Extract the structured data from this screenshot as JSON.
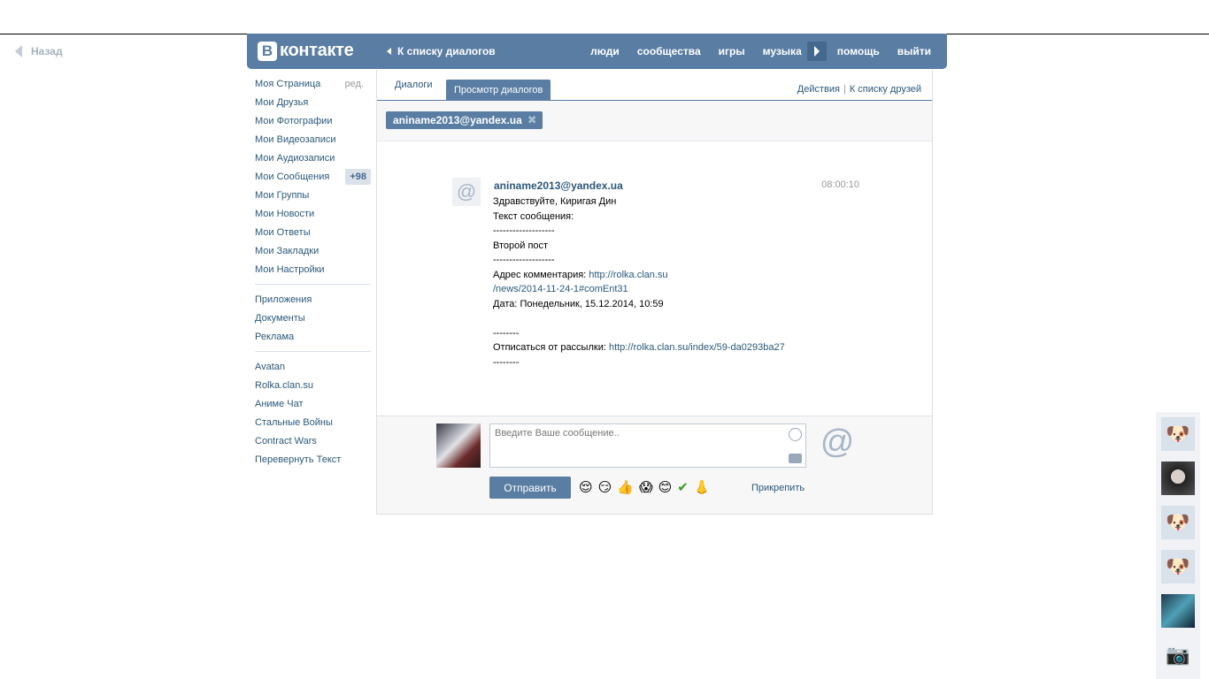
{
  "back": {
    "label": "Назад"
  },
  "header": {
    "logo_b": "В",
    "logo_text": "контакте",
    "to_dialogs": "К списку диалогов",
    "nav": [
      "люди",
      "сообщества",
      "игры",
      "музыка",
      "помощь",
      "выйти"
    ]
  },
  "sidebar": {
    "items": [
      {
        "label": "Моя Страница",
        "extra": "ред."
      },
      {
        "label": "Мои Друзья"
      },
      {
        "label": "Мои Фотографии"
      },
      {
        "label": "Мои Видеозаписи"
      },
      {
        "label": "Мои Аудиозаписи"
      },
      {
        "label": "Мои Сообщения",
        "badge": "+98"
      },
      {
        "label": "Мои Группы"
      },
      {
        "label": "Мои Новости"
      },
      {
        "label": "Мои Ответы"
      },
      {
        "label": "Мои Закладки"
      },
      {
        "label": "Мои Настройки"
      }
    ],
    "group2": [
      "Приложения",
      "Документы",
      "Реклама"
    ],
    "group3": [
      "Avatan",
      "Rolka.clan.su",
      "Аниме Чат",
      "Стальные Войны",
      "Contract Wars",
      "Перевернуть Текст"
    ]
  },
  "tabs": {
    "dialogs": "Диалоги",
    "view": "Просмотр диалогов",
    "actions": "Действия",
    "friends": "К списку друзей"
  },
  "chip": {
    "label": "aniname2013@yandex.ua"
  },
  "message": {
    "avatar": "@",
    "author": "aniname2013@yandex.ua",
    "time": "08:00:10",
    "greeting": "Здравствуйте, Киригая Дин",
    "body_lines": [
      "",
      "Текст сообщения:",
      "-------------------",
      "Второй пост",
      "-------------------"
    ],
    "addr_label": "Адрес комментария: ",
    "addr_link1": "http://rolka.clan.su",
    "addr_link2": "/news/2014-11-24-1#comEnt31",
    "date_line": "Дата: Понедельник, 15.12.2014, 10:59",
    "dash1": "--------",
    "unsub_label": "Отписаться от рассылки: ",
    "unsub_link": "http://rolka.clan.su/index/59-da0293ba27",
    "dash2": "--------"
  },
  "reply": {
    "placeholder": "Введите Ваше сообщение..",
    "at": "@",
    "send": "Отправить",
    "emojis": [
      "😌",
      "😏",
      "👍",
      "😱",
      "😊",
      "✔",
      "👃"
    ],
    "attach": "Прикрепить"
  }
}
